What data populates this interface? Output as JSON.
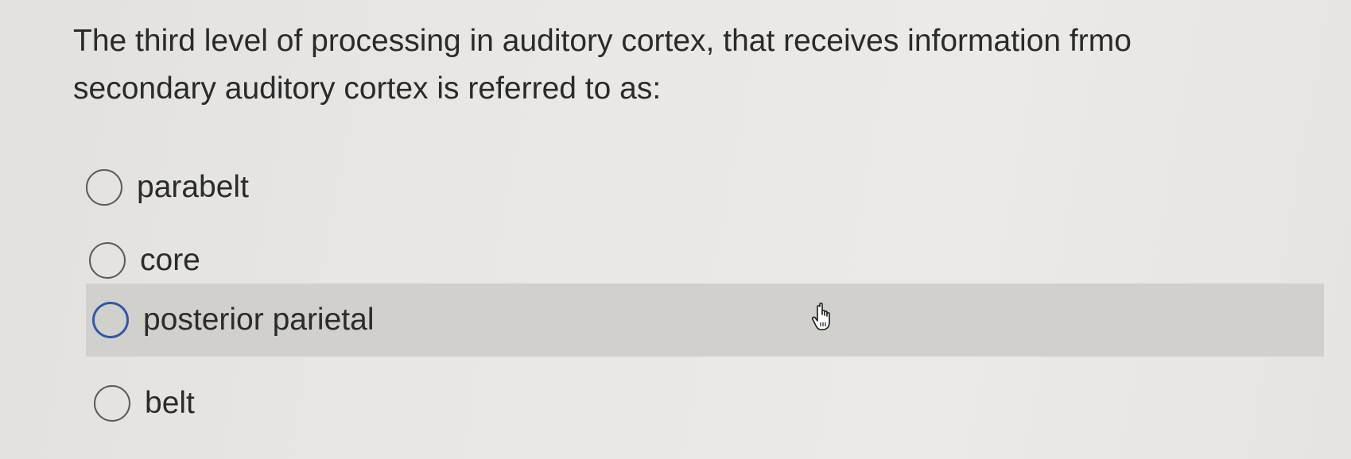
{
  "question": {
    "text": "The third level of processing in auditory cortex, that receives information frmo secondary auditory cortex is referred to as:"
  },
  "options": [
    {
      "label": "parabelt",
      "selected": false,
      "hovered": false
    },
    {
      "label": "core",
      "selected": false,
      "hovered": false
    },
    {
      "label": "posterior parietal",
      "selected": false,
      "hovered": true
    },
    {
      "label": "belt",
      "selected": false,
      "hovered": false
    }
  ],
  "colors": {
    "background": "#e9e7e4",
    "hover_highlight": "#d2d0cd",
    "focus_ring": "#2e5aa8",
    "text": "#2b2b2b"
  },
  "cursor": {
    "icon": "hand-pointer-icon"
  }
}
